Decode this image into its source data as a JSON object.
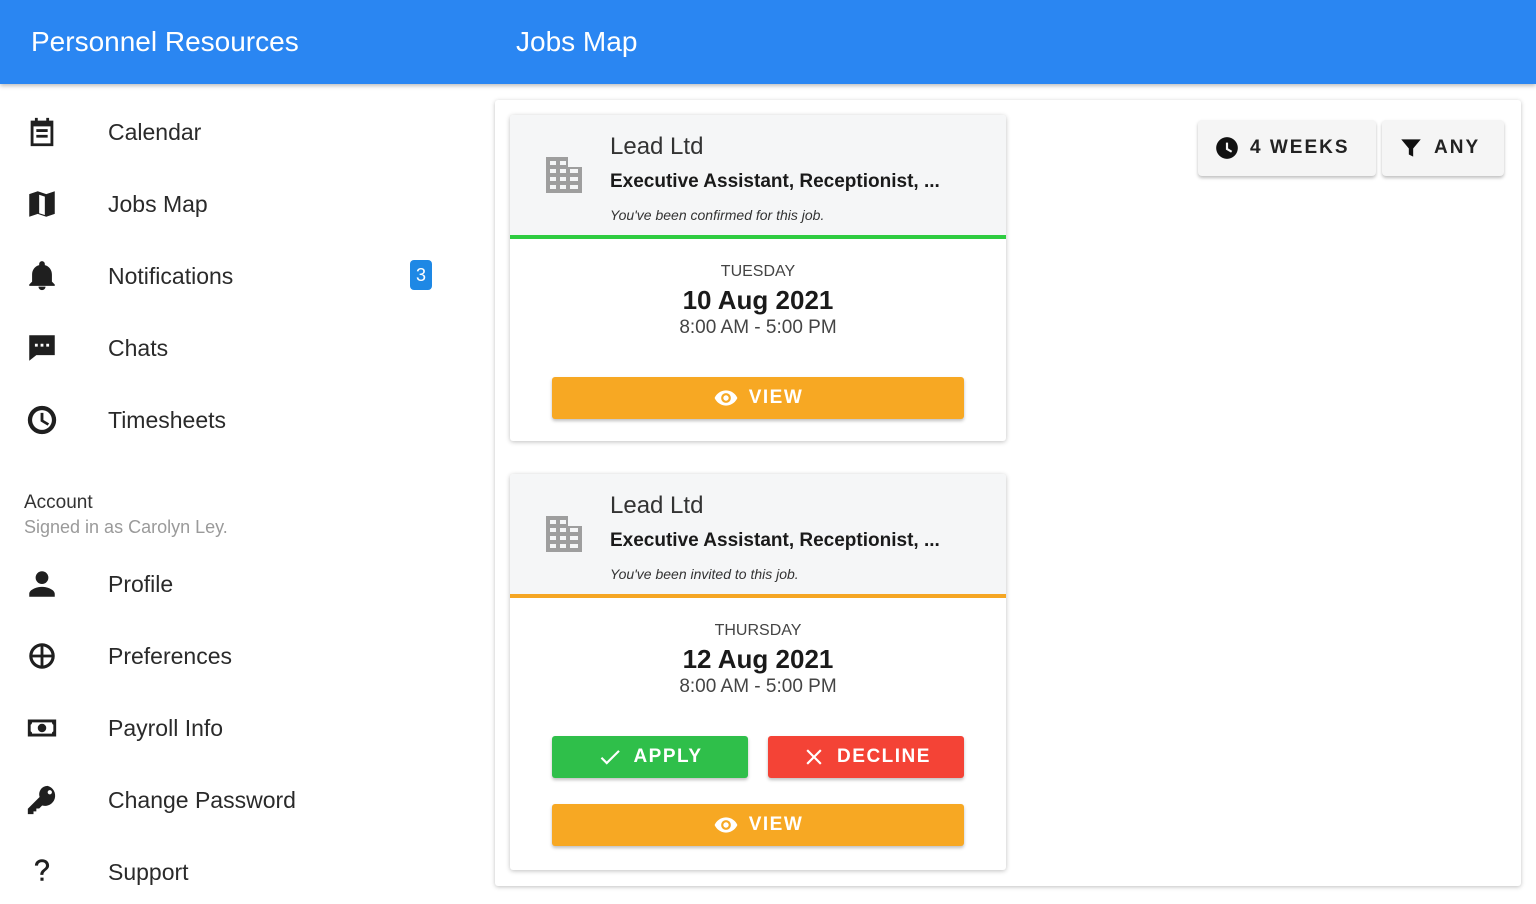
{
  "appbar": {
    "app_title": "Personnel Resources",
    "page_title": "Jobs Map",
    "color": "#2a86f2"
  },
  "nav": {
    "items": [
      {
        "label": "Calendar",
        "icon": "calendar-icon"
      },
      {
        "label": "Jobs Map",
        "icon": "map-icon"
      },
      {
        "label": "Notifications",
        "icon": "bell-icon",
        "badge": "3"
      },
      {
        "label": "Chats",
        "icon": "chat-icon"
      },
      {
        "label": "Timesheets",
        "icon": "timesheet-icon"
      }
    ],
    "account_heading": "Account",
    "account_sub": "Signed in as Carolyn Ley.",
    "account_items": [
      {
        "label": "Profile",
        "icon": "person-icon"
      },
      {
        "label": "Preferences",
        "icon": "preferences-icon"
      },
      {
        "label": "Payroll Info",
        "icon": "money-icon"
      },
      {
        "label": "Change Password",
        "icon": "key-icon"
      },
      {
        "label": "Support",
        "icon": "help-icon"
      }
    ]
  },
  "filters": {
    "weeks_label": "4 WEEKS",
    "any_label": "ANY"
  },
  "jobs": [
    {
      "company": "Lead Ltd",
      "roles": "Executive Assistant, Receptionist, ...",
      "note": "You've been confirmed for this job.",
      "status_color": "#2ecc40",
      "day": "TUESDAY",
      "date": "10 Aug 2021",
      "time": "8:00 AM - 5:00 PM",
      "view_label": "VIEW"
    },
    {
      "company": "Lead Ltd",
      "roles": "Executive Assistant, Receptionist, ...",
      "note": "You've been invited to this job.",
      "status_color": "#f5a623",
      "day": "THURSDAY",
      "date": "12 Aug 2021",
      "time": "8:00 AM - 5:00 PM",
      "apply_label": "APPLY",
      "decline_label": "DECLINE",
      "view_label": "VIEW"
    }
  ]
}
